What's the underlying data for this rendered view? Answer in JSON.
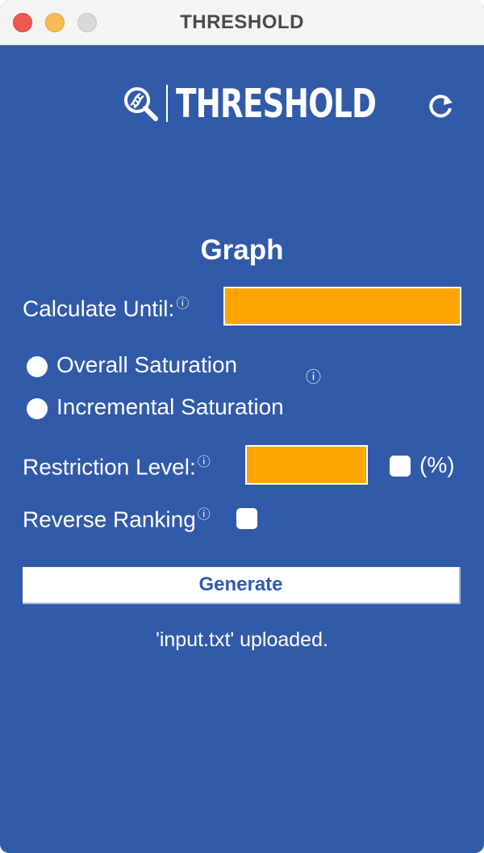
{
  "window": {
    "title": "THRESHOLD"
  },
  "logo": {
    "text": "THRESHOLD"
  },
  "section": {
    "heading": "Graph"
  },
  "form": {
    "calculate_until": {
      "label": "Calculate Until:",
      "value": ""
    },
    "radios": {
      "overall": "Overall Saturation",
      "incremental": "Incremental Saturation"
    },
    "restriction_level": {
      "label": "Restriction Level:",
      "value": "",
      "percent_label": "(%)"
    },
    "reverse_ranking": {
      "label": "Reverse Ranking"
    },
    "info_glyph": "ⓘ"
  },
  "actions": {
    "generate_label": "Generate"
  },
  "status": {
    "message": "'input.txt' uploaded."
  },
  "colors": {
    "background": "#315aa9",
    "field": "#ffa500",
    "text": "#ffffff"
  }
}
